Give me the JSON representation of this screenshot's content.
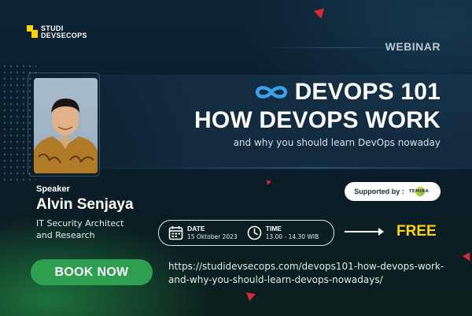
{
  "brand": {
    "logo_line1": "STUDI",
    "logo_line2": "DEVSECOPS",
    "accent": "#ffd200"
  },
  "badge": {
    "label": "WEBINAR"
  },
  "title": {
    "line1": "DEVOPS 101",
    "line2": "HOW DEVOPS WORK",
    "subtitle": "and why you should learn DevOps nowaday",
    "icon": "infinity-icon",
    "icon_color": "#3aa0e8"
  },
  "speaker": {
    "label": "Speaker",
    "name": "Alvin Senjaya",
    "role_line1": "IT Security Architect",
    "role_line2": "and Research"
  },
  "support": {
    "label": "Supported by :",
    "sponsor": "TEMIRA"
  },
  "event": {
    "date_label": "DATE",
    "date_value": "15 Oktober 2023",
    "time_label": "TIME",
    "time_value": "13.00 - 14.30 WIB"
  },
  "price": {
    "label": "FREE",
    "color": "#ffd400"
  },
  "cta": {
    "label": "BOOK NOW",
    "color": "#2e9e4f"
  },
  "link": {
    "line1": "https://studidevsecops.com/devops101-how-devops-work-",
    "line2": "and-why-you-should-learn-devops-nowadays/"
  }
}
